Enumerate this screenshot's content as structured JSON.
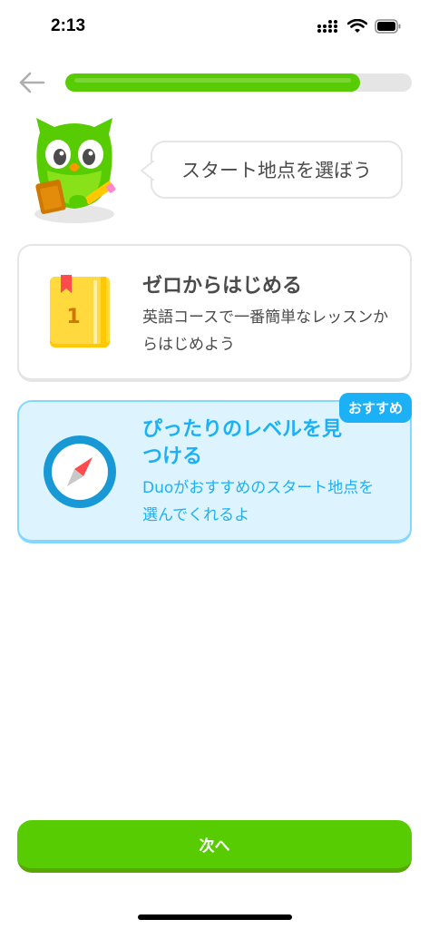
{
  "status_bar": {
    "time": "2:13",
    "icons": [
      "cellular-signal-icon",
      "wifi-icon",
      "battery-icon"
    ]
  },
  "header": {
    "back_icon": "arrow-left-icon",
    "progress": 0.85
  },
  "prompt": {
    "mascot_icon": "owl-mascot-icon",
    "text": "スタート地点を選ぼう"
  },
  "options": [
    {
      "icon": "book-icon",
      "icon_number": "1",
      "title": "ゼロからはじめる",
      "description": "英語コースで一番簡単なレッスンからはじめよう",
      "selected": false
    },
    {
      "icon": "compass-icon",
      "title": "ぴったりのレベルを見つける",
      "description": "Duoがおすすめのスタート地点を選んでくれるよ",
      "badge": "おすすめ",
      "selected": true
    }
  ],
  "footer": {
    "next_label": "次へ"
  },
  "colors": {
    "accent_green": "#58cc02",
    "accent_blue": "#1cb0f6",
    "selected_bg": "#ddf4ff",
    "text_gray": "#4b4b4b"
  }
}
